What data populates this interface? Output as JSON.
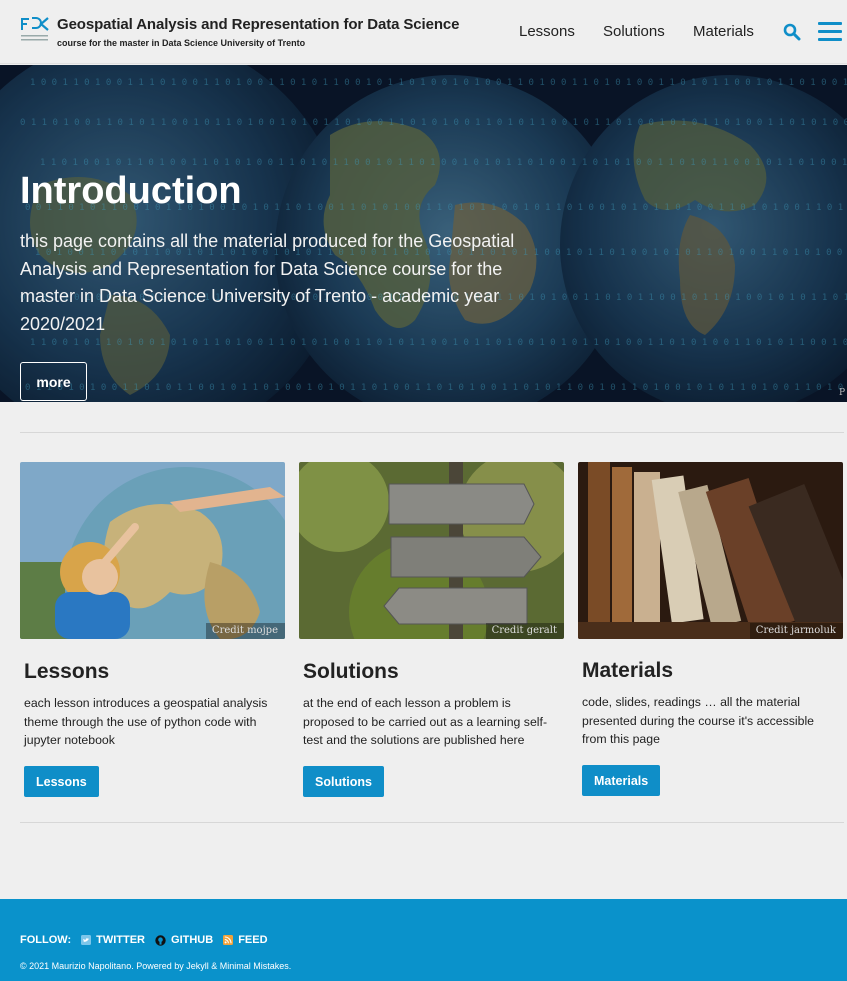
{
  "header": {
    "site_title": "Geospatial Analysis and Representation for Data Science",
    "site_subtitle": "course for the master in Data Science University of Trento",
    "nav": [
      "Lessons",
      "Solutions",
      "Materials"
    ]
  },
  "hero": {
    "title": "Introduction",
    "text": "this page contains all the material produced for the Geospatial Analysis and Representation for Data Science course for the master in Data Science University of Trento - academic year 2020/2021",
    "button": "more",
    "credit": "P"
  },
  "cards": [
    {
      "title": "Lessons",
      "text": "each lesson introduces a geospatial analysis theme through the use of python code with jupyter notebook",
      "button": "Lessons",
      "credit": "Credit mojpe"
    },
    {
      "title": "Solutions",
      "text": "at the end of each lesson a problem is proposed to be carried out as a learning self-test and the solutions are published here",
      "button": "Solutions",
      "credit": "Credit geralt"
    },
    {
      "title": "Materials",
      "text": "code, slides, readings … all the material presented during the course it's accessible from this page",
      "button": "Materials",
      "credit": "Credit jarmoluk"
    }
  ],
  "footer": {
    "follow_label": "FOLLOW:",
    "links": [
      "TWITTER",
      "GITHUB",
      "FEED"
    ],
    "copyright": "© 2021 Maurizio Napolitano. Powered by Jekyll & Minimal Mistakes."
  },
  "colors": {
    "accent": "#0f8ec8",
    "footer": "#0a92cb",
    "background": "#efefef"
  }
}
